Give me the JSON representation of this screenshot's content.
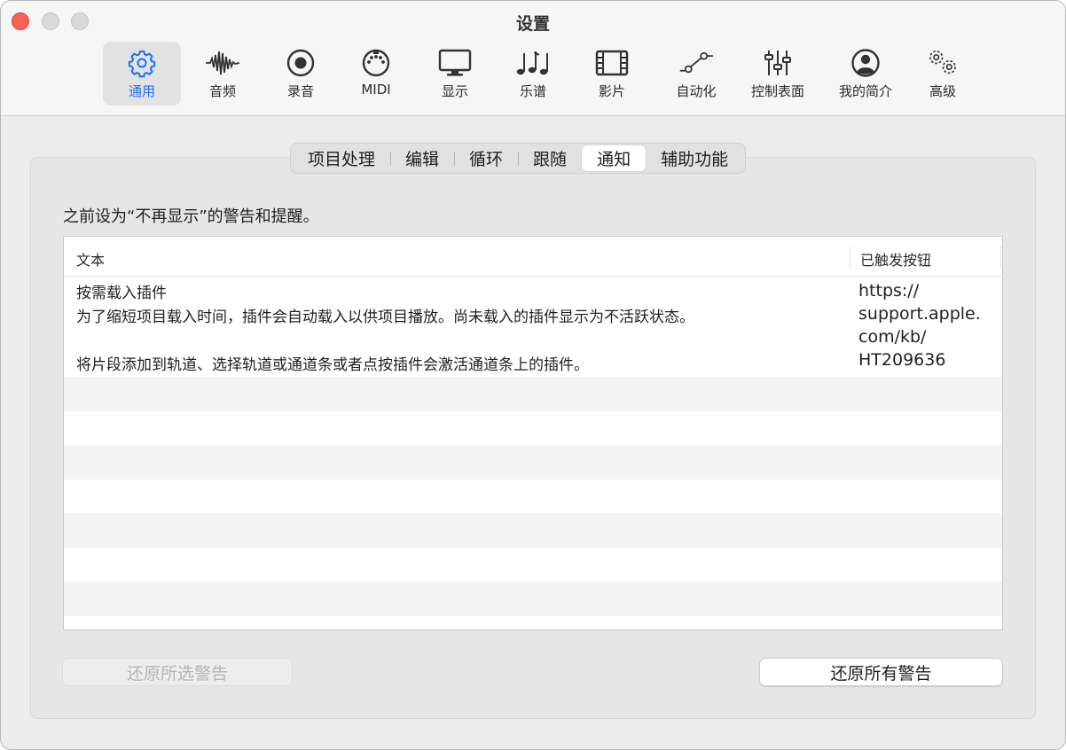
{
  "window": {
    "title": "设置"
  },
  "toolbar": {
    "items": [
      {
        "label": "通用",
        "icon": "gear-icon",
        "selected": true
      },
      {
        "label": "音频",
        "icon": "waveform-icon"
      },
      {
        "label": "录音",
        "icon": "record-icon"
      },
      {
        "label": "MIDI",
        "icon": "midi-port-icon"
      },
      {
        "label": "显示",
        "icon": "display-icon"
      },
      {
        "label": "乐谱",
        "icon": "music-notes-icon"
      },
      {
        "label": "影片",
        "icon": "film-icon"
      },
      {
        "label": "自动化",
        "icon": "automation-icon"
      },
      {
        "label": "控制表面",
        "icon": "sliders-icon"
      },
      {
        "label": "我的简介",
        "icon": "profile-icon"
      },
      {
        "label": "高级",
        "icon": "gears-icon"
      }
    ]
  },
  "tabs": [
    {
      "label": "项目处理"
    },
    {
      "label": "编辑"
    },
    {
      "label": "循环"
    },
    {
      "label": "跟随"
    },
    {
      "label": "通知",
      "active": true
    },
    {
      "label": "辅助功能"
    }
  ],
  "description": "之前设为“不再显示”的警告和提醒。",
  "table": {
    "columns": [
      "文本",
      "已触发按钮"
    ],
    "rows": [
      {
        "text_lines": [
          "按需载入插件",
          "为了缩短项目载入时间，插件会自动载入以供项目播放。尚未载入的插件显示为不活跃状态。",
          "将片段添加到轨道、选择轨道或通道条或者点按插件会激活通道条上的插件。"
        ],
        "button_lines": [
          "https://",
          "support.apple.",
          "com/kb/",
          "HT209636"
        ]
      }
    ]
  },
  "buttons": {
    "restore_selected": "还原所选警告",
    "restore_all": "还原所有警告"
  },
  "colors": {
    "accent": "#1d6ff2",
    "close": "#fe5f57"
  }
}
